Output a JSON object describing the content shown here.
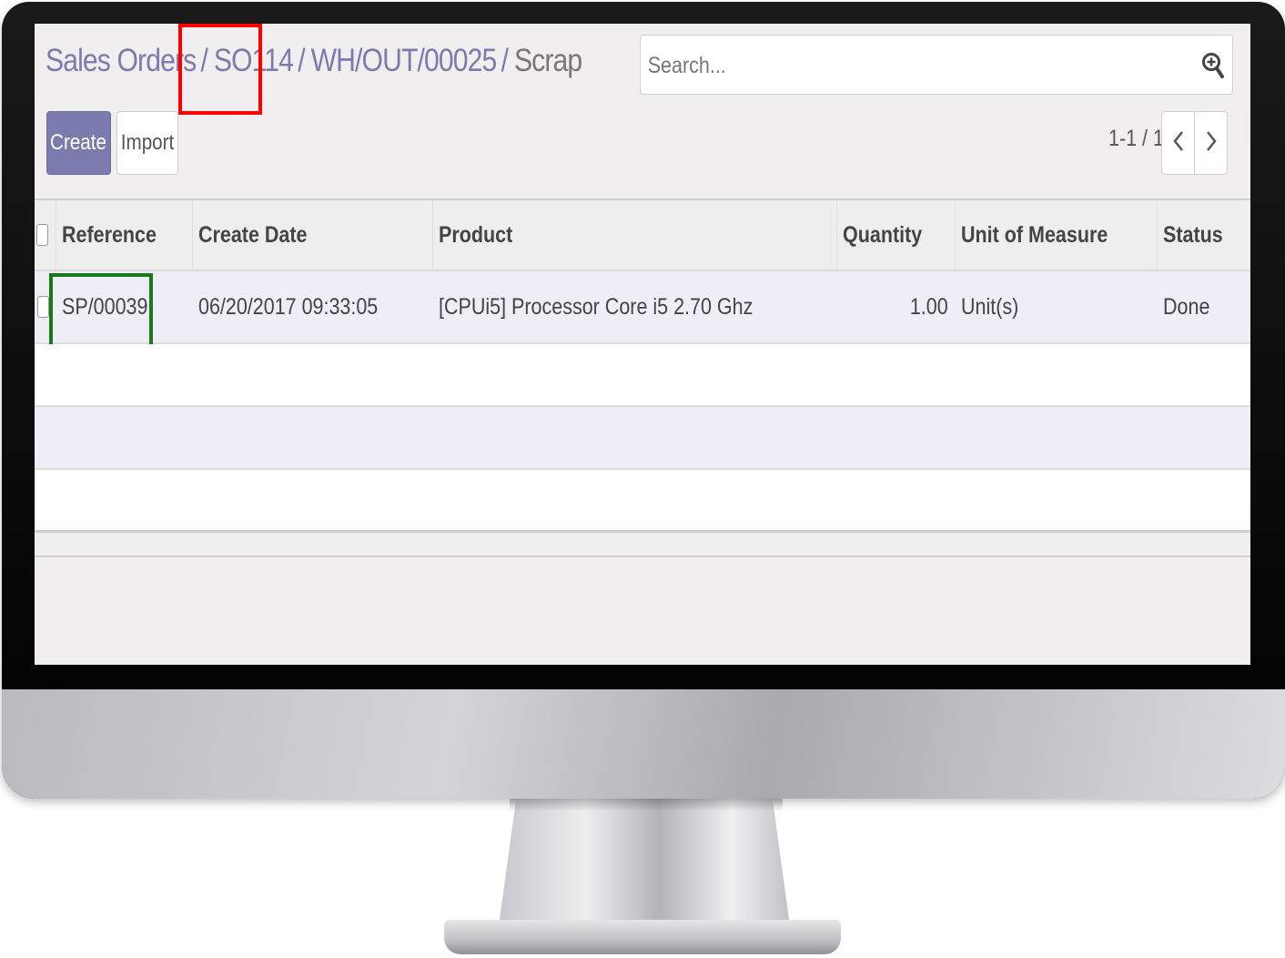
{
  "breadcrumb": {
    "items": [
      {
        "label": "Sales Orders"
      },
      {
        "label": "SO114"
      },
      {
        "label": "WH/OUT/00025"
      },
      {
        "label": "Scrap"
      }
    ],
    "separator": "/"
  },
  "search": {
    "placeholder": "Search...",
    "value": ""
  },
  "toolbar": {
    "create_label": "Create",
    "import_label": "Import"
  },
  "pager": {
    "value": "1-1 / 1"
  },
  "table": {
    "columns": [
      "Reference",
      "Create Date",
      "Product",
      "Quantity",
      "Unit of Measure",
      "Status"
    ],
    "rows": [
      {
        "reference": "SP/00039",
        "create_date": "06/20/2017 09:33:05",
        "product": "[CPUi5] Processor Core i5 2.70 Ghz",
        "quantity": "1.00",
        "uom": "Unit(s)",
        "status": "Done"
      }
    ]
  },
  "colors": {
    "brand": "#7c7bad",
    "highlight_breadcrumb": "#ff0000",
    "highlight_reference": "#1a7a1a"
  },
  "icons": {
    "search": "search-icon",
    "pager_prev": "chevron-left-icon",
    "pager_next": "chevron-right-icon"
  }
}
